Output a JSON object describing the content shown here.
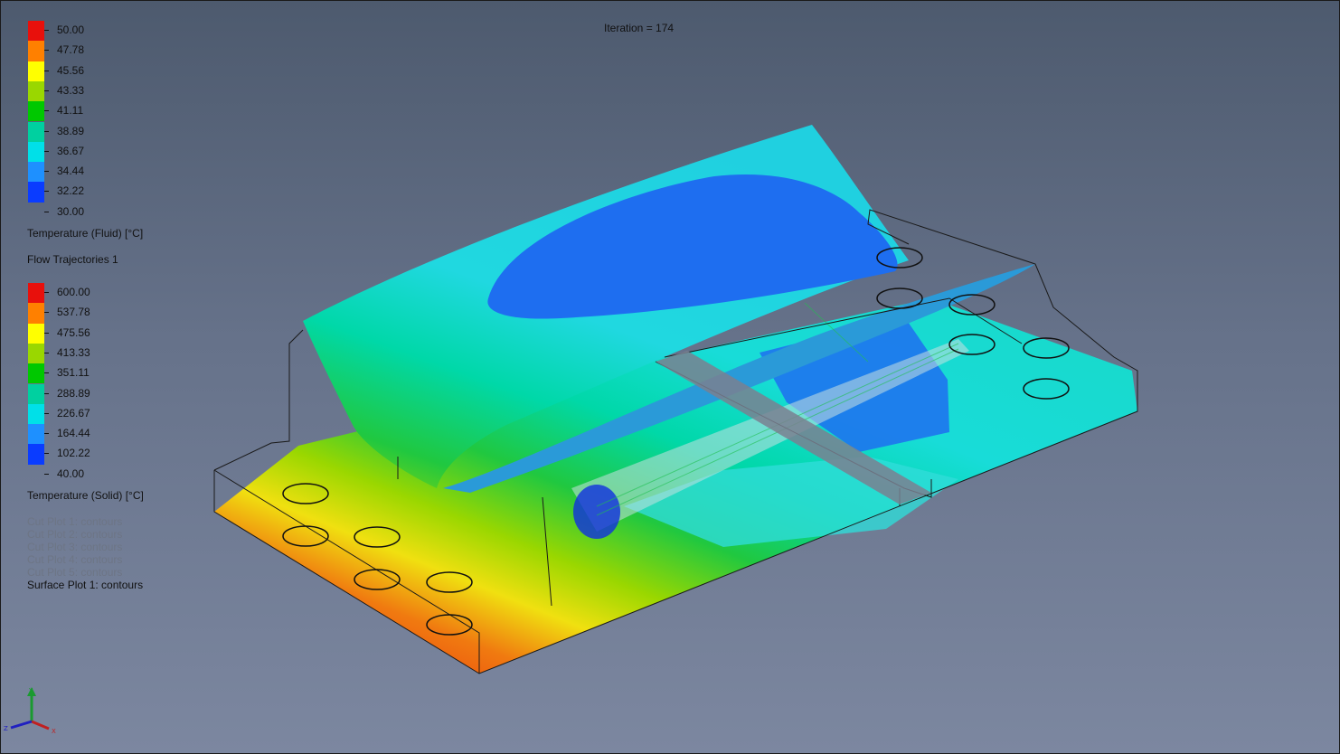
{
  "iteration_text": "Iteration = 174",
  "fluid_legend": {
    "title": "Temperature (Fluid) [°C]",
    "labels": [
      "50.00",
      "47.78",
      "45.56",
      "43.33",
      "41.11",
      "38.89",
      "36.67",
      "34.44",
      "32.22",
      "30.00"
    ],
    "colors": [
      "#e8100c",
      "#ff8000",
      "#ffff00",
      "#9ad700",
      "#00c800",
      "#00d0a0",
      "#00e0e8",
      "#1e90ff",
      "#0a3cff"
    ]
  },
  "trajectories_title": "Flow Trajectories 1",
  "solid_legend": {
    "title": "Temperature (Solid) [°C]",
    "labels": [
      "600.00",
      "537.78",
      "475.56",
      "413.33",
      "351.11",
      "288.89",
      "226.67",
      "164.44",
      "102.22",
      "40.00"
    ],
    "colors": [
      "#e8100c",
      "#ff8000",
      "#ffff00",
      "#9ad700",
      "#00c800",
      "#00d0a0",
      "#00e0e8",
      "#1e90ff",
      "#0a3cff"
    ]
  },
  "plot_list": [
    {
      "label": "Cut Plot 1: contours",
      "active": false
    },
    {
      "label": "Cut Plot 2: contours",
      "active": false
    },
    {
      "label": "Cut Plot 3: contours",
      "active": false
    },
    {
      "label": "Cut Plot 4: contours",
      "active": false
    },
    {
      "label": "Cut Plot 5: contours",
      "active": false
    },
    {
      "label": "Surface Plot 1: contours",
      "active": true
    }
  ],
  "triad_axes": {
    "y": "Y",
    "x": "X",
    "z": "Z"
  }
}
